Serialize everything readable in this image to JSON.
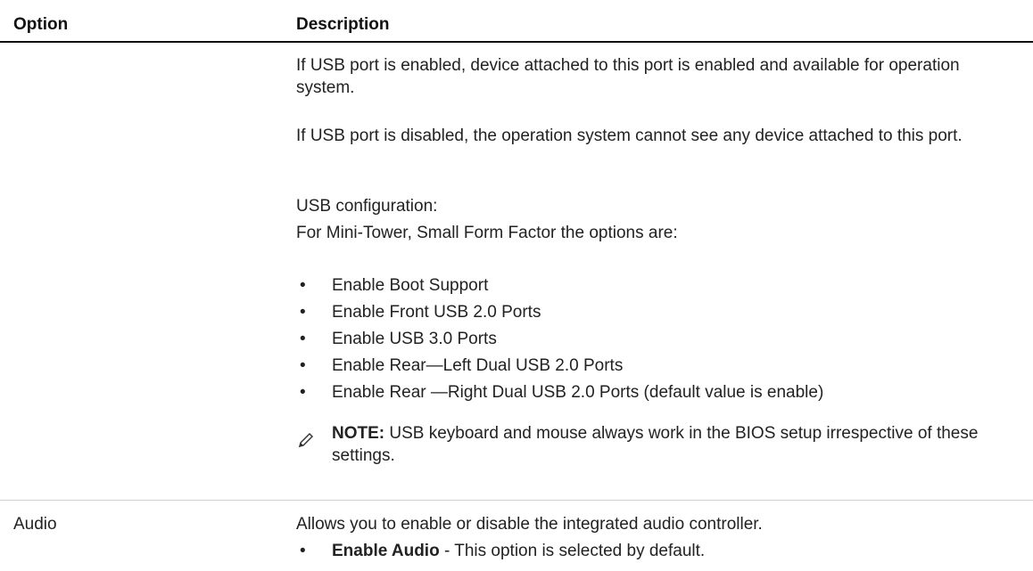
{
  "table": {
    "header": {
      "option": "Option",
      "description": "Description"
    },
    "usb": {
      "para1": "If USB port is enabled, device attached to this port is enabled and available for operation system.",
      "para2": "If USB port is disabled, the operation system cannot see any device attached to this port.",
      "config_heading": "USB configuration:",
      "config_intro": "For Mini-Tower, Small Form Factor the options are:",
      "options": [
        "Enable Boot Support",
        "Enable Front USB 2.0 Ports",
        "Enable USB 3.0 Ports",
        "Enable Rear—Left Dual USB 2.0 Ports",
        "Enable Rear —Right Dual USB 2.0 Ports (default value is enable)"
      ],
      "note_label": "NOTE:",
      "note_text": " USB keyboard and mouse always work in the BIOS setup irrespective of these settings."
    },
    "audio": {
      "option": "Audio",
      "description": "Allows you to enable or disable the integrated audio controller.",
      "bullet_label": "Enable Audio",
      "bullet_text": " - This option is selected by default."
    }
  },
  "icons": {
    "note": "pencil-note-icon"
  },
  "bullet_char": "•"
}
